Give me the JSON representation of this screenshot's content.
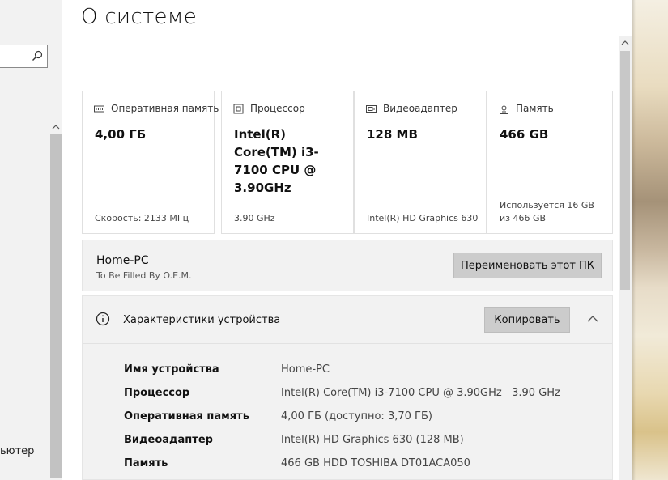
{
  "sidebar": {
    "partial_text": "ьютер"
  },
  "page": {
    "title": "О системе"
  },
  "cards": [
    {
      "label": "Оперативная память",
      "icon": "memory-icon",
      "value": "4,00 ГБ",
      "footer": "Скорость: 2133 МГц"
    },
    {
      "label": "Процессор",
      "icon": "cpu-icon",
      "value": "Intel(R) Core(TM) i3-7100 CPU @ 3.90GHz",
      "footer": "3.90 GHz"
    },
    {
      "label": "Видеоадаптер",
      "icon": "gpu-icon",
      "value": "128 MB",
      "footer": "Intel(R) HD Graphics 630"
    },
    {
      "label": "Память",
      "icon": "storage-icon",
      "value": "466 GB",
      "footer": "Используется 16 GB из 466 GB"
    }
  ],
  "pc": {
    "name": "Home-PC",
    "model": "To Be Filled By O.E.M.",
    "rename_label": "Переименовать этот ПК"
  },
  "specs": {
    "title": "Характеристики устройства",
    "copy_label": "Копировать",
    "rows": [
      {
        "label": "Имя устройства",
        "value": "Home-PC"
      },
      {
        "label": "Процессор",
        "value": "Intel(R) Core(TM) i3-7100 CPU @ 3.90GHz   3.90 GHz"
      },
      {
        "label": "Оперативная память",
        "value": "4,00 ГБ (доступно: 3,70 ГБ)"
      },
      {
        "label": "Видеоадаптер",
        "value": "Intel(R) HD Graphics 630 (128 MB)"
      },
      {
        "label": "Память",
        "value": "466 GB HDD TOSHIBA DT01ACA050"
      }
    ]
  },
  "colors": {
    "panel_bg": "#f2f2f2",
    "button_bg": "#cccccc",
    "card_border": "#e0e0e0"
  }
}
